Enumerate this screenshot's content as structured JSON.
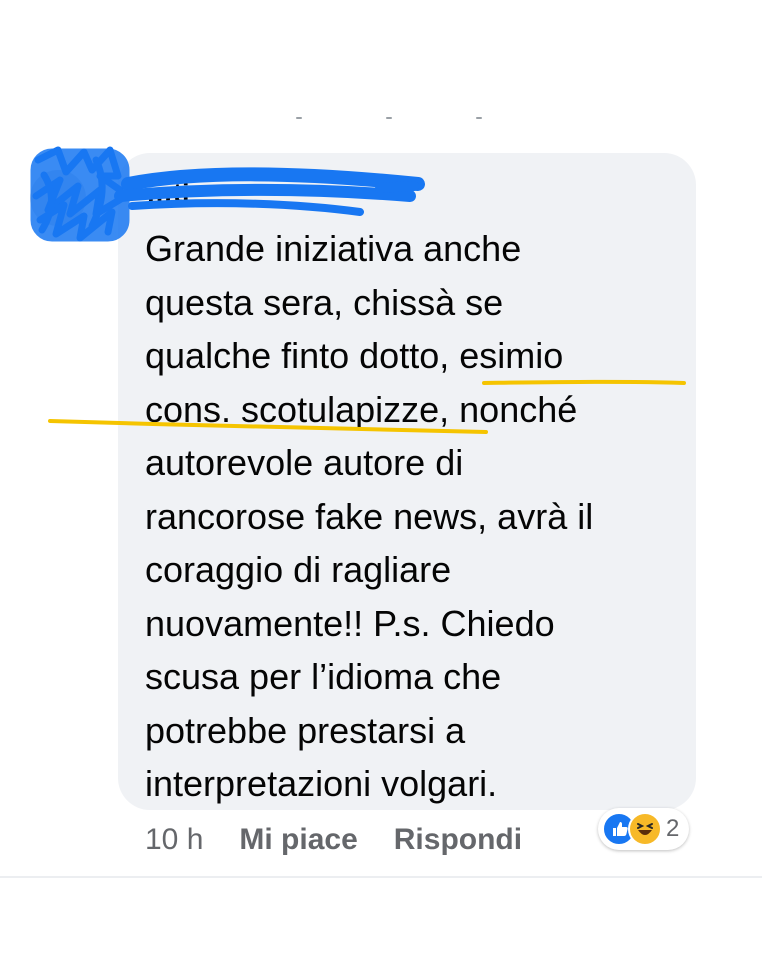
{
  "comment": {
    "author": "…ti",
    "lines": [
      "Grande iniziativa anche",
      "questa sera, chissà se",
      "qualche finto dotto, esimio",
      "cons. scotulapizze, nonché",
      "autorevole autore di",
      "rancorose fake news, avrà il",
      "coraggio di ragliare",
      "nuovamente!! P.s. Chiedo",
      "scusa per l’idioma che",
      "potrebbe prestarsi a",
      "interpretazioni volgari."
    ],
    "timestamp": "10 h",
    "like_label": "Mi piace",
    "reply_label": "Rispondi",
    "reaction_icons": [
      "like-icon",
      "haha-icon"
    ],
    "reaction_count": "2"
  },
  "colors": {
    "bubble": "#f0f2f5",
    "text": "#050505",
    "meta": "#65676b",
    "scribble": "#1877f2",
    "highlight": "#f5c400",
    "like": "#1877f2",
    "haha": "#f7b928"
  }
}
